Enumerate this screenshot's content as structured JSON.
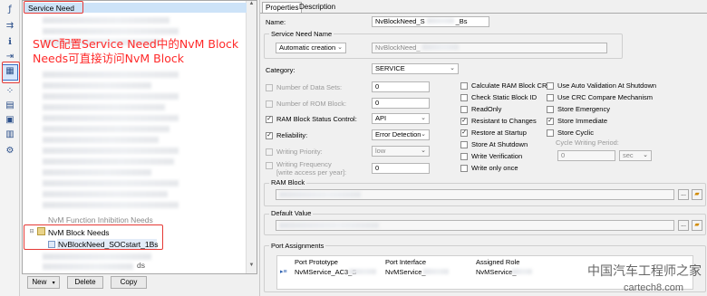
{
  "toolbar": {
    "icons": [
      "function-icon",
      "swc-icon",
      "interface-icon",
      "port-icon",
      "service-need-icon",
      "runnable-icon",
      "data-type-icon",
      "memory-icon",
      "mapping-icon",
      "settings-icon"
    ]
  },
  "tree": {
    "root_label": "Service Need",
    "nvm_group_label": "NvM Block Needs",
    "selected_item": "NvBlockNeed_SOCstart_1Bs",
    "partial_item": "NvM Function Inhibition Needs",
    "partial_item2": "ds"
  },
  "annotation": "SWC配置Service  Need中的NvM  Block  Needs可直接访问NvM  Block",
  "bottom_buttons": {
    "new": "New",
    "delete": "Delete",
    "copy": "Copy"
  },
  "tabs": {
    "properties": "Properties",
    "description": "Description"
  },
  "form": {
    "name_label": "Name:",
    "name_value": "NvBlockNeed_S",
    "name_suffix": "_Bs",
    "service_need_name_title": "Service Need Name",
    "service_need_name_mode": "Automatic creation",
    "service_need_name_value": "NvBlockNeed_",
    "category_label": "Category:",
    "category_value": "SERVICE",
    "number_of_data_sets_label": "Number of Data Sets:",
    "number_of_data_sets_value": "0",
    "number_of_rom_block_label": "Number of ROM Block:",
    "number_of_rom_block_value": "0",
    "ram_block_status_control_label": "RAM Block Status Control:",
    "ram_block_status_control_value": "API",
    "reliability_label": "Reliability:",
    "reliability_value": "Error Detection",
    "writing_priority_label": "Writing Priority:",
    "writing_priority_value": "low",
    "writing_frequency_label": "Writing Frequency",
    "writing_frequency_label2": "[write access per year]:",
    "writing_frequency_value": "0",
    "cycle_writing_period_label": "Cycle Writing Period:",
    "cycle_writing_period_value": "0",
    "cycle_writing_period_unit": "sec",
    "ram_block_title": "RAM Block",
    "default_value_title": "Default Value",
    "port_assignments_title": "Port Assignments",
    "browse_label": "...",
    "checkboxes_col1": [
      {
        "label": "Calculate RAM Block CRC",
        "checked": false
      },
      {
        "label": "Check Static Block ID",
        "checked": false
      },
      {
        "label": "ReadOnly",
        "checked": false
      },
      {
        "label": "Resistant to Changes",
        "checked": true
      },
      {
        "label": "Restore at Startup",
        "checked": true
      },
      {
        "label": "Store At Shutdown",
        "checked": false
      },
      {
        "label": "Write Verification",
        "checked": false
      },
      {
        "label": "Write only once",
        "checked": false
      }
    ],
    "checkboxes_col2": [
      {
        "label": "Use Auto Validation At Shutdown",
        "checked": false
      },
      {
        "label": "Use CRC Compare Mechanism",
        "checked": false
      },
      {
        "label": "Store Emergency",
        "checked": false
      },
      {
        "label": "Store Immediate",
        "checked": true
      },
      {
        "label": "Store Cyclic",
        "checked": false
      }
    ],
    "left_checks": {
      "number_of_data_sets": false,
      "number_of_rom_block": false,
      "ram_block_status_control": true,
      "reliability": true,
      "writing_priority": false,
      "writing_frequency": false
    }
  },
  "port_table": {
    "headers": [
      "Port Prototype",
      "Port Interface",
      "Assigned Role"
    ],
    "row": [
      "NvMService_AC3_S",
      "NvMService_",
      "NvMService_"
    ]
  },
  "watermark": {
    "line1": "中国汽车工程师之家",
    "line2": "cartech8.com"
  }
}
